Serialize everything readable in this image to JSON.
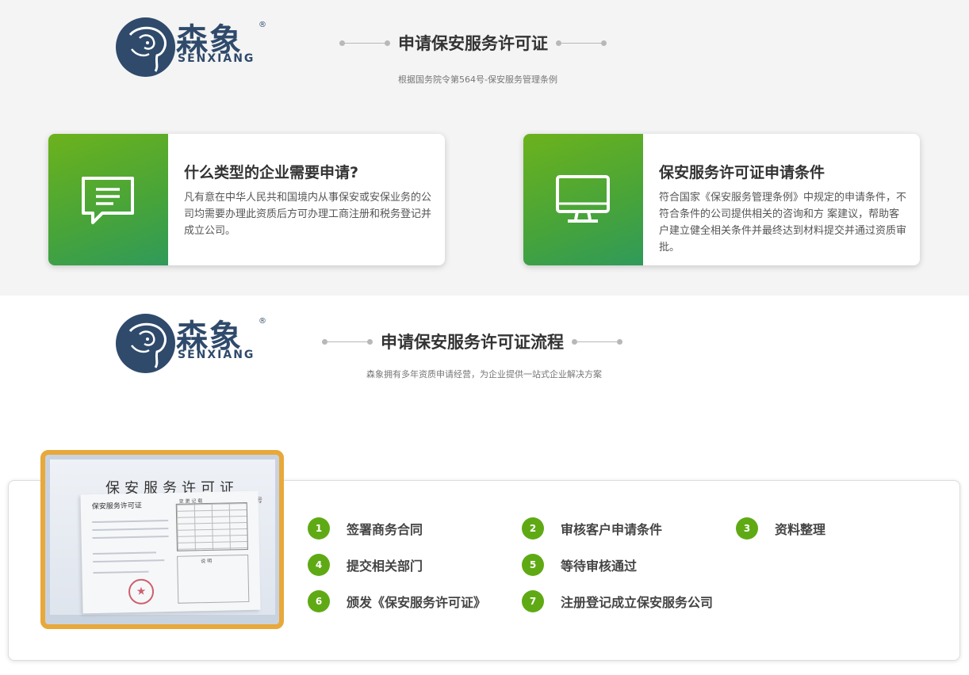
{
  "brand": {
    "name_cn": "森象",
    "name_en": "SENXIANG",
    "registered": "®"
  },
  "section1": {
    "title": "申请保安服务许可证",
    "subtitle": "根据国务院令第564号-保安服务管理条例"
  },
  "cards": [
    {
      "icon": "chat-bubble-icon",
      "title": "什么类型的企业需要申请?",
      "desc": "凡有意在中华人民共和国境内从事保安或安保业务的公司均需要办理此资质后方可办理工商注册和税务登记并成立公司。"
    },
    {
      "icon": "monitor-icon",
      "title": "保安服务许可证申请条件",
      "desc": "符合国家《保安服务管理条例》中规定的申请条件，不符合条件的公司提供相关的咨询和方 案建议，帮助客户建立健全相关条件并最终达到材料提交并通过资质审批。"
    }
  ],
  "section2": {
    "title": "申请保安服务许可证流程",
    "subtitle": "森象拥有多年资质申请经营，为企业提供一站式企业解决方案"
  },
  "certificate_photo": {
    "title": "保安服务许可证",
    "inner_title": "保安服务许可证",
    "number_suffix": "号",
    "table_head": "变 更 记 载",
    "table_head2": "说  明"
  },
  "steps": [
    {
      "num": "1",
      "label": "签署商务合同"
    },
    {
      "num": "2",
      "label": "审核客户申请条件"
    },
    {
      "num": "3",
      "label": "资料整理"
    },
    {
      "num": "4",
      "label": "提交相关部门"
    },
    {
      "num": "5",
      "label": "等待审核通过"
    },
    {
      "num": "6",
      "label": "颁发《保安服务许可证》"
    },
    {
      "num": "7",
      "label": "注册登记成立保安服务公司"
    }
  ],
  "colors": {
    "brand_navy": "#2f4a6b",
    "green": "#5faa14",
    "photo_border": "#e8a83a"
  }
}
